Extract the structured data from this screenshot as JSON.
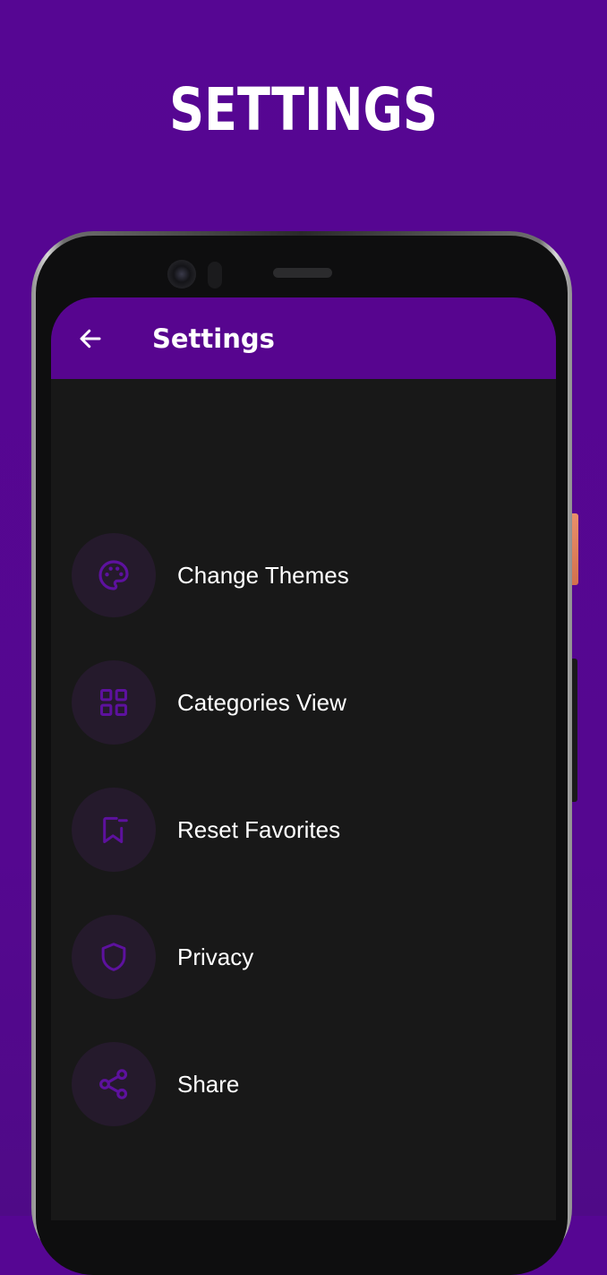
{
  "banner": {
    "title": "SETTINGS"
  },
  "app_bar": {
    "back_icon": "arrow-left-icon",
    "title": "Settings"
  },
  "colors": {
    "background": "#560693",
    "app_bar": "#57058f",
    "screen": "#181818",
    "icon_circle": "#251a2c",
    "icon": "#5d119e",
    "text": "#ffffff"
  },
  "menu": {
    "items": [
      {
        "label": "Change Themes",
        "icon": "palette-icon"
      },
      {
        "label": "Categories View",
        "icon": "grid-icon"
      },
      {
        "label": "Reset Favorites",
        "icon": "bookmark-remove-icon"
      },
      {
        "label": "Privacy",
        "icon": "shield-icon"
      },
      {
        "label": "Share",
        "icon": "share-icon"
      }
    ]
  }
}
